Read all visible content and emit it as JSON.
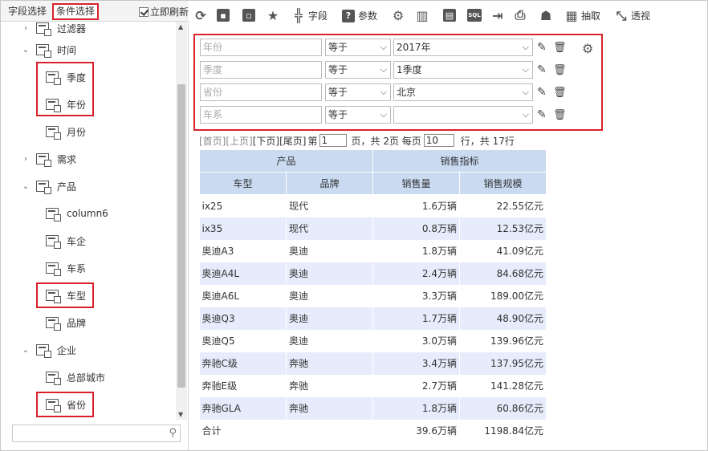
{
  "left_panel": {
    "tab_field_select": "字段选择",
    "tab_condition_select": "条件选择",
    "refresh_label": "立即刷新",
    "refresh_checked": true,
    "tree": [
      {
        "label": "过滤器",
        "level": 0,
        "expand": "collapsed"
      },
      {
        "label": "时间",
        "level": 0,
        "expand": "expanded"
      },
      {
        "label": "季度",
        "level": 1,
        "highlighted": true
      },
      {
        "label": "年份",
        "level": 1,
        "highlighted": true
      },
      {
        "label": "月份",
        "level": 1
      },
      {
        "label": "需求",
        "level": 0,
        "expand": "collapsed"
      },
      {
        "label": "产品",
        "level": 0,
        "expand": "expanded"
      },
      {
        "label": "column6",
        "level": 1
      },
      {
        "label": "车企",
        "level": 1
      },
      {
        "label": "车系",
        "level": 1
      },
      {
        "label": "车型",
        "level": 1,
        "highlighted": true
      },
      {
        "label": "品牌",
        "level": 1
      },
      {
        "label": "企业",
        "level": 0,
        "expand": "expanded"
      },
      {
        "label": "总部城市",
        "level": 1
      },
      {
        "label": "省份",
        "level": 1,
        "highlighted": true
      }
    ],
    "search_placeholder": ""
  },
  "toolbar": {
    "field_label": "字段",
    "param_label": "参数",
    "extract_label": "抽取",
    "pivot_label": "透视",
    "sql_label": "SQL"
  },
  "conditions": [
    {
      "field": "年份",
      "operator": "等于",
      "value": "2017年"
    },
    {
      "field": "季度",
      "operator": "等于",
      "value": "1季度"
    },
    {
      "field": "省份",
      "operator": "等于",
      "value": "北京"
    },
    {
      "field": "车系",
      "operator": "等于",
      "value": ""
    }
  ],
  "pager": {
    "first": "[首页]",
    "prev": "[上页]",
    "next": "[下页]",
    "last": "[尾页]",
    "page_prefix": "第",
    "page_value": "1",
    "page_suffix": "页，共 2页 每页",
    "per_page": "10",
    "rows_suffix": "行，共 17行"
  },
  "table": {
    "group_headers": [
      "产品",
      "销售指标"
    ],
    "columns": [
      "车型",
      "品牌",
      "销售量",
      "销售规模"
    ],
    "rows": [
      [
        "ix25",
        "现代",
        "1.6万辆",
        "22.55亿元"
      ],
      [
        "ix35",
        "现代",
        "0.8万辆",
        "12.53亿元"
      ],
      [
        "奥迪A3",
        "奥迪",
        "1.8万辆",
        "41.09亿元"
      ],
      [
        "奥迪A4L",
        "奥迪",
        "2.4万辆",
        "84.68亿元"
      ],
      [
        "奥迪A6L",
        "奥迪",
        "3.3万辆",
        "189.00亿元"
      ],
      [
        "奥迪Q3",
        "奥迪",
        "1.7万辆",
        "48.90亿元"
      ],
      [
        "奥迪Q5",
        "奥迪",
        "3.0万辆",
        "139.96亿元"
      ],
      [
        "奔驰C级",
        "奔驰",
        "3.4万辆",
        "137.95亿元"
      ],
      [
        "奔驰E级",
        "奔驰",
        "2.7万辆",
        "141.28亿元"
      ],
      [
        "奔驰GLA",
        "奔驰",
        "1.8万辆",
        "60.86亿元"
      ]
    ],
    "total": [
      "合计",
      "",
      "39.6万辆",
      "1198.84亿元"
    ]
  },
  "colors": {
    "highlight": "#d9212b",
    "header_bg": "#c9daf1",
    "row_alt_bg": "#e6ecfb"
  }
}
